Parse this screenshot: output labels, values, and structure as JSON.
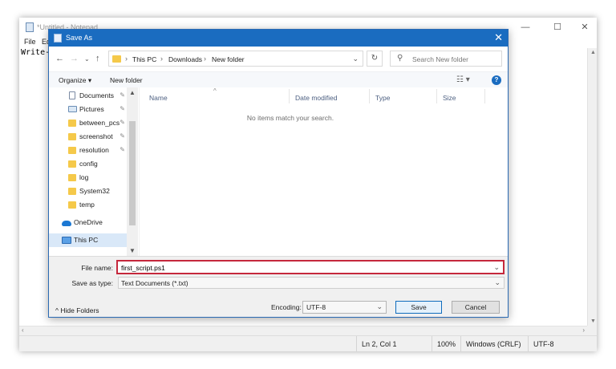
{
  "notepad": {
    "title": "*Untitled - Notepad",
    "menu": [
      "File",
      "Ed"
    ],
    "text_line": "Write-",
    "status": {
      "position": "Ln 2, Col 1",
      "zoom": "100%",
      "line_ending": "Windows (CRLF)",
      "encoding": "UTF-8"
    }
  },
  "dialog": {
    "title": "Save As",
    "address": {
      "crumbs": [
        "This PC",
        "Downloads",
        "New folder"
      ]
    },
    "search": {
      "placeholder": "Search New folder"
    },
    "commands": {
      "organize": "Organize ▾",
      "new_folder": "New folder"
    },
    "nav_items": [
      {
        "label": "Documents",
        "icon": "documents-icon",
        "pinned": true
      },
      {
        "label": "Pictures",
        "icon": "pictures-icon",
        "pinned": true
      },
      {
        "label": "between_pcs",
        "icon": "folder-icon",
        "pinned": true
      },
      {
        "label": "screenshot",
        "icon": "folder-icon",
        "pinned": true
      },
      {
        "label": "resolution",
        "icon": "folder-icon",
        "pinned": true
      },
      {
        "label": "config",
        "icon": "folder-icon",
        "pinned": false
      },
      {
        "label": "log",
        "icon": "folder-icon",
        "pinned": false
      },
      {
        "label": "System32",
        "icon": "folder-icon",
        "pinned": false
      },
      {
        "label": "temp",
        "icon": "folder-icon",
        "pinned": false
      },
      {
        "label": "OneDrive",
        "icon": "onedrive-icon",
        "pinned": false
      },
      {
        "label": "This PC",
        "icon": "this-pc-icon",
        "pinned": false,
        "selected": true
      }
    ],
    "columns": [
      "Name",
      "Date modified",
      "Type",
      "Size"
    ],
    "empty_message": "No items match your search.",
    "file_name_label": "File name:",
    "file_name_value": "first_script.ps1",
    "save_as_type_label": "Save as type:",
    "save_as_type_value": "Text Documents (*.txt)",
    "hide_folders": "Hide Folders",
    "encoding_label": "Encoding:",
    "encoding_value": "UTF-8",
    "save_button": "Save",
    "cancel_button": "Cancel"
  },
  "colors": {
    "title_bar": "#1a6cc0",
    "highlight_border": "#c5283c",
    "folder": "#f5c94a"
  }
}
